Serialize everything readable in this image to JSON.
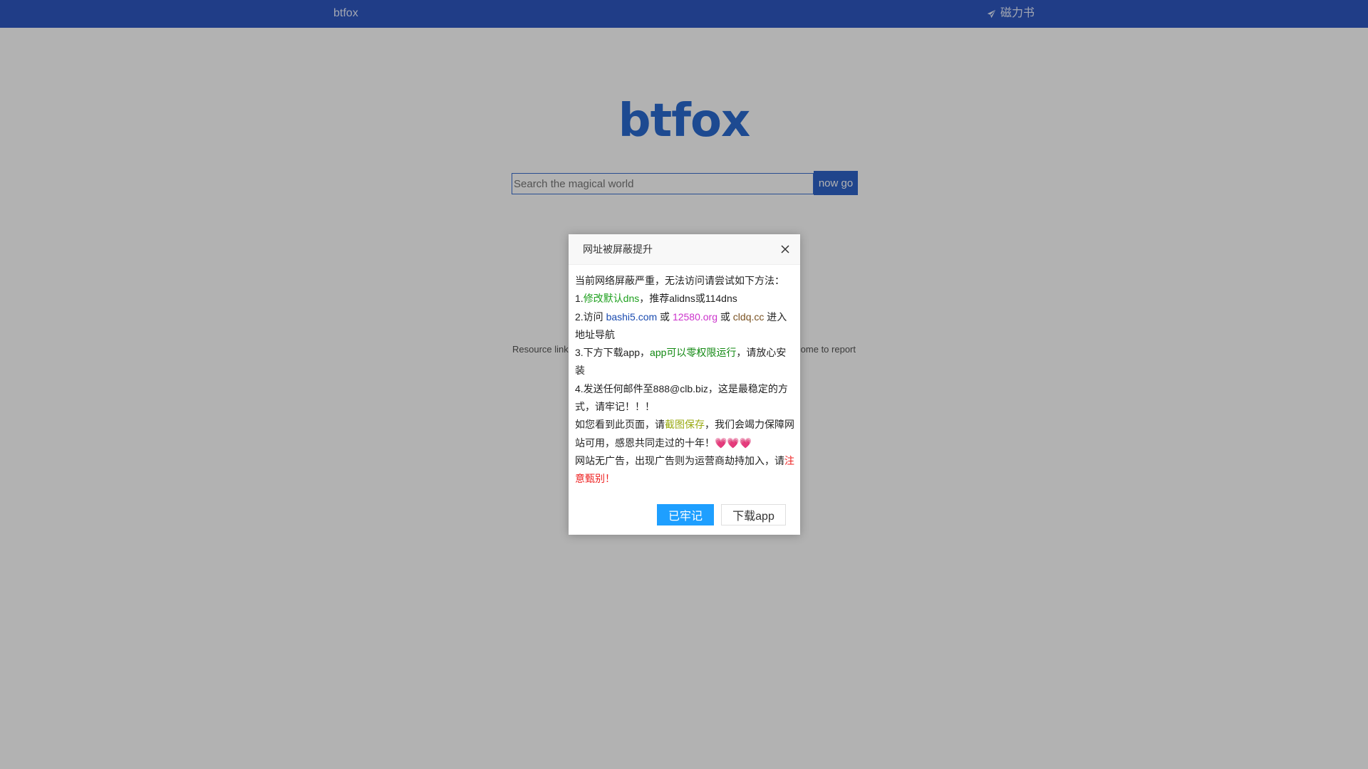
{
  "topbar": {
    "brand": "btfox",
    "right_link": "磁力书",
    "right_icon": "send-icon",
    "color": "#2e58c2"
  },
  "logo": {
    "text": "btfox",
    "color": "#2a6ad0"
  },
  "search": {
    "placeholder": "Search the magical world",
    "value": "",
    "button_label": "now go"
  },
  "footer_note": {
    "left_text": "Resource link",
    "right_text": "ome to report"
  },
  "dialog": {
    "title": "网址被屏蔽提升",
    "close_icon": "close-icon",
    "intro": "当前网络屏蔽严重，无法访问请尝试如下方法：",
    "item1": {
      "prefix": "1.",
      "highlight": "修改默认dns",
      "suffix": "，推荐alidns或114dns"
    },
    "item2": {
      "prefix": "2.访问 ",
      "link1": "bashi5.com",
      "or1": " 或 ",
      "link2": "12580.org",
      "or2": " 或 ",
      "link3": "cldq.cc",
      "suffix": " 进入地址导航"
    },
    "item3": {
      "prefix": "3.下方下载app，",
      "highlight": "app可以零权限运行",
      "suffix": "，请放心安装"
    },
    "item4": "4.发送任何邮件至888@clb.biz，这是最稳定的方式，请牢记！！！",
    "note1": {
      "prefix": "如您看到此页面，请",
      "highlight": "截图保存",
      "suffix": "，我们会竭力保障网站可用，感恩共同走过的十年！💗💗💗"
    },
    "note2": {
      "prefix": "网站无广告，出现广告则为运营商劫持加入，请",
      "highlight": "注意甄别！"
    },
    "buttons": {
      "primary": "已牢记",
      "secondary": "下载app"
    },
    "colors": {
      "primary_button": "#1e9fff",
      "green": "#1ea01e",
      "blue": "#1a4bb0",
      "magenta": "#cc33cc",
      "brown": "#7a5222",
      "dark_green": "#118811",
      "olive": "#99aa11",
      "red": "#ee2222"
    }
  }
}
